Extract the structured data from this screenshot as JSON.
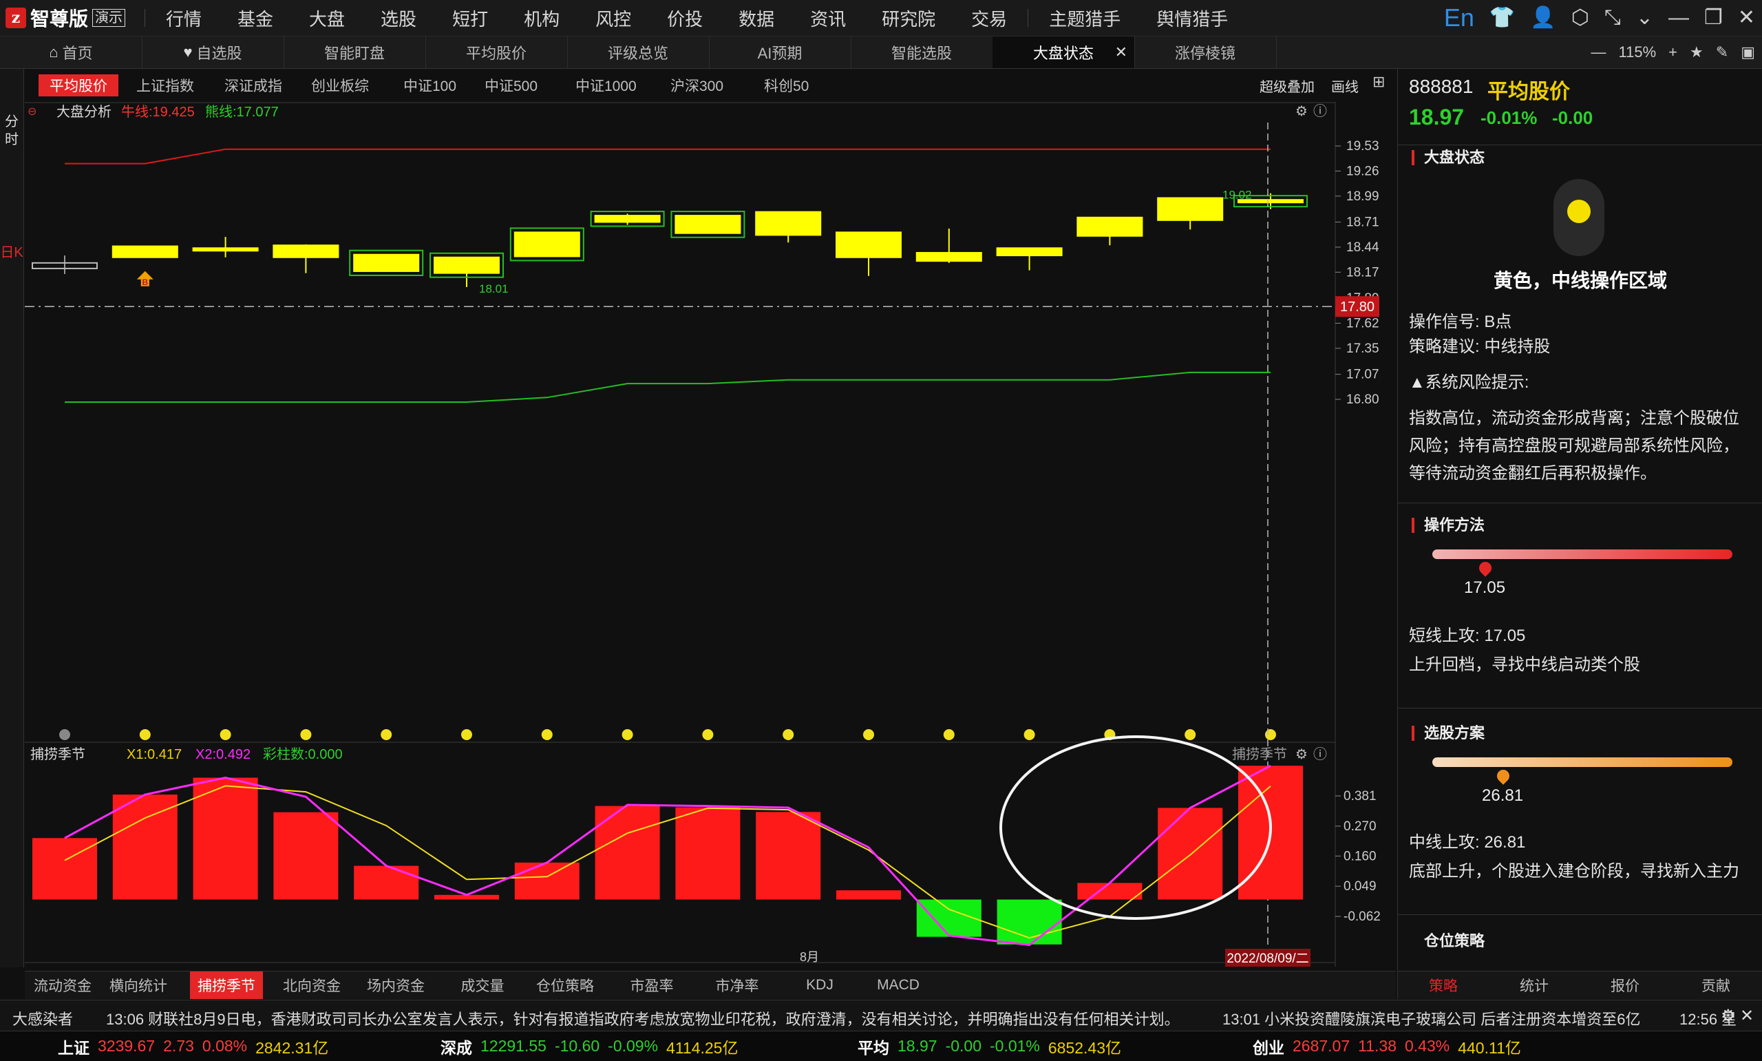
{
  "app": {
    "name": "智尊版",
    "mode_badge": "演示"
  },
  "main_menu": [
    "行情",
    "基金",
    "大盘",
    "选股",
    "短打",
    "机构",
    "风控",
    "价投",
    "数据",
    "资讯",
    "研究院",
    "交易",
    "主题猎手",
    "舆情猎手"
  ],
  "top_icons": {
    "lang": "En"
  },
  "tabs": [
    {
      "label": "首页",
      "icon": "home-icon"
    },
    {
      "label": "自选股",
      "icon": "heart-icon"
    },
    {
      "label": "智能盯盘"
    },
    {
      "label": "平均股价"
    },
    {
      "label": "评级总览"
    },
    {
      "label": "AI预期"
    },
    {
      "label": "智能选股"
    },
    {
      "label": "大盘状态",
      "active": true,
      "closable": true
    },
    {
      "label": "涨停棱镜"
    }
  ],
  "zoom": "115%",
  "left_vertical": {
    "intraday": "分时",
    "daily": "日K"
  },
  "index_tabs": [
    "平均股价",
    "上证指数",
    "深证成指",
    "创业板综",
    "中证100",
    "中证500",
    "中证1000",
    "沪深300",
    "科创50"
  ],
  "chart_tools": {
    "overlay": "超级叠加",
    "draw": "画线"
  },
  "main_chart": {
    "label": "大盘分析",
    "bull_label": "牛线:19.425",
    "bear_label": "熊线:17.077",
    "current_price_label": "17.80",
    "date_label": "2022/08/09/二",
    "month_label": "8月",
    "high_marker": "19.02",
    "low_marker": "18.01",
    "b_marker": "B"
  },
  "sub_chart": {
    "label": "捕捞季节",
    "x1_label": "X1:0.417",
    "x2_label": "X2:0.492",
    "count_label": "彩柱数:0.000",
    "corner_label": "捕捞季节"
  },
  "chart_data": [
    {
      "type": "candlestick",
      "title": "大盘分析",
      "ylim": [
        16.6,
        19.7
      ],
      "yticks": [
        "19.53",
        "19.26",
        "18.99",
        "18.71",
        "18.44",
        "18.17",
        "17.89",
        "17.62",
        "17.35",
        "17.07",
        "16.80"
      ],
      "current_price": 17.8,
      "candles": [
        {
          "o": 18.27,
          "h": 18.35,
          "l": 18.15,
          "c": 18.21,
          "style": "gray"
        },
        {
          "o": 18.33,
          "h": 18.45,
          "l": 18.33,
          "c": 18.45,
          "style": "yellow"
        },
        {
          "o": 18.43,
          "h": 18.55,
          "l": 18.33,
          "c": 18.42,
          "style": "yellow"
        },
        {
          "o": 18.33,
          "h": 18.47,
          "l": 18.16,
          "c": 18.46,
          "style": "yellow"
        },
        {
          "o": 18.36,
          "h": 18.36,
          "l": 18.18,
          "c": 18.18,
          "style": "yellow-box"
        },
        {
          "o": 18.16,
          "h": 18.33,
          "l": 18.01,
          "c": 18.33,
          "style": "yellow-box"
        },
        {
          "o": 18.34,
          "h": 18.6,
          "l": 18.34,
          "c": 18.6,
          "style": "yellow-box"
        },
        {
          "o": 18.71,
          "h": 18.8,
          "l": 18.68,
          "c": 18.78,
          "style": "yellow-box"
        },
        {
          "o": 18.78,
          "h": 18.78,
          "l": 18.6,
          "c": 18.59,
          "style": "yellow-box"
        },
        {
          "o": 18.82,
          "h": 18.82,
          "l": 18.49,
          "c": 18.57,
          "style": "yellow"
        },
        {
          "o": 18.6,
          "h": 18.6,
          "l": 18.13,
          "c": 18.33,
          "style": "yellow"
        },
        {
          "o": 18.38,
          "h": 18.64,
          "l": 18.27,
          "c": 18.29,
          "style": "yellow"
        },
        {
          "o": 18.43,
          "h": 18.43,
          "l": 18.19,
          "c": 18.35,
          "style": "yellow"
        },
        {
          "o": 18.56,
          "h": 18.76,
          "l": 18.46,
          "c": 18.76,
          "style": "yellow"
        },
        {
          "o": 18.73,
          "h": 18.97,
          "l": 18.63,
          "c": 18.97,
          "style": "yellow"
        },
        {
          "o": 18.95,
          "h": 19.02,
          "l": 18.85,
          "c": 18.93,
          "style": "yellow-box"
        }
      ],
      "bull_line": [
        19.34,
        19.34,
        19.495,
        19.495,
        19.495,
        19.495,
        19.495,
        19.495,
        19.495,
        19.495,
        19.495,
        19.495,
        19.495,
        19.495,
        19.495,
        19.495
      ],
      "bear_line": [
        16.77,
        16.77,
        16.77,
        16.77,
        16.77,
        16.77,
        16.82,
        16.97,
        16.97,
        17.01,
        17.01,
        17.01,
        17.01,
        17.01,
        17.09,
        17.09
      ],
      "dots": [
        "gray",
        "yellow",
        "yellow",
        "yellow",
        "yellow",
        "yellow",
        "yellow",
        "yellow",
        "yellow",
        "yellow",
        "yellow",
        "yellow",
        "yellow",
        "yellow",
        "yellow",
        "yellow"
      ]
    },
    {
      "type": "bar",
      "title": "捕捞季节",
      "ylim": [
        -0.16,
        0.5
      ],
      "yticks": [
        "0.381",
        "0.270",
        "0.160",
        "0.049",
        "-0.062"
      ],
      "bars": [
        0.226,
        0.386,
        0.448,
        0.321,
        0.124,
        0.017,
        0.136,
        0.344,
        0.339,
        0.322,
        0.034,
        -0.137,
        -0.165,
        0.061,
        0.337,
        0.492
      ],
      "x1_line": [
        0.144,
        0.3,
        0.418,
        0.396,
        0.272,
        0.074,
        0.084,
        0.244,
        0.336,
        0.33,
        0.182,
        -0.036,
        -0.141,
        -0.062,
        0.164,
        0.417
      ],
      "x2_line": [
        0.226,
        0.386,
        0.448,
        0.378,
        0.124,
        0.017,
        0.136,
        0.348,
        0.344,
        0.338,
        0.192,
        -0.132,
        -0.167,
        0.061,
        0.337,
        0.492
      ]
    }
  ],
  "right_panel": {
    "code": "888881",
    "name": "平均股价",
    "price": "18.97",
    "change_pct": "-0.01%",
    "change": "-0.00",
    "status_title": "大盘状态",
    "status_text": "黄色，中线操作区域",
    "signal": "操作信号: B点",
    "suggestion": "策略建议: 中线持股",
    "risk_title": "▲系统风险提示:",
    "risk_text": "指数高位，流动资金形成背离；注意个股破位风险；持有高控盘股可规避局部系统性风险，等待流动资金翻红后再积极操作。",
    "method_title": "操作方法",
    "method_value": "17.05",
    "method_line1": "短线上攻: 17.05",
    "method_line2": "上升回档，寻找中线启动类个股",
    "pick_title": "选股方案",
    "pick_value": "26.81",
    "pick_line1": "中线上攻: 26.81",
    "pick_line2": "底部上升，个股进入建仓阶段，寻找新入主力",
    "position_title": "仓位策略",
    "colors": {
      "status": "#f5e000",
      "accent": "#e52626"
    }
  },
  "sub_tabs": [
    "流动资金",
    "横向统计",
    "捕捞季节",
    "北向资金",
    "场内资金",
    "成交量",
    "仓位策略",
    "市盈率",
    "市净率",
    "KDJ",
    "MACD"
  ],
  "right_tabs": [
    "策略",
    "统计",
    "报价",
    "贡献"
  ],
  "news": {
    "left_fragment": "大感染者",
    "item1": "13:06 财联社8月9日电，香港财政司司长办公室发言人表示，针对有报道指政府考虑放宽物业印花税，政府澄清，没有相关讨论，并明确指出没有任何相关计划。",
    "item2": "13:01 小米投资醴陵旗滨电子玻璃公司 后者注册资本增资至6亿",
    "time": "12:56 星"
  },
  "status_bar": [
    {
      "name": "上证",
      "value": "3239.67",
      "change": "2.73",
      "pct": "0.08%",
      "amount": "2842.31亿",
      "dir": "up"
    },
    {
      "name": "深成",
      "value": "12291.55",
      "change": "-10.60",
      "pct": "-0.09%",
      "amount": "4114.25亿",
      "dir": "dn"
    },
    {
      "name": "平均",
      "value": "18.97",
      "change": "-0.00",
      "pct": "-0.01%",
      "amount": "6852.43亿",
      "dir": "dn"
    },
    {
      "name": "创业",
      "value": "2687.07",
      "change": "11.38",
      "pct": "0.43%",
      "amount": "440.11亿",
      "dir": "up"
    }
  ]
}
